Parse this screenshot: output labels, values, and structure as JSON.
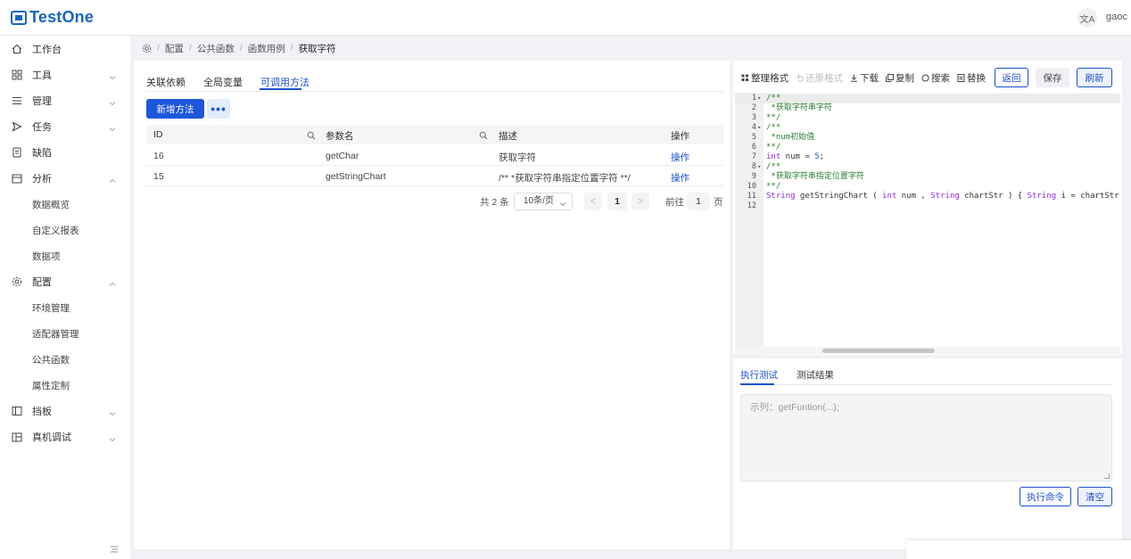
{
  "app": {
    "name": "TestOne",
    "lang_icon": "文A",
    "user": "gaoc"
  },
  "colors": {
    "accent": "#1e4fd0",
    "primary_button": "#1e57dc",
    "logo": "#1565c0",
    "comment": "#2e7d32"
  },
  "sidebar": {
    "items": [
      {
        "label": "工作台",
        "icon": "home-icon"
      },
      {
        "label": "工具",
        "icon": "grid-icon"
      },
      {
        "label": "管理",
        "icon": "list-icon"
      },
      {
        "label": "任务",
        "icon": "send-icon"
      },
      {
        "label": "缺陷",
        "icon": "document-icon"
      },
      {
        "label": "分析",
        "icon": "calendar-icon"
      },
      {
        "label": "数据概览"
      },
      {
        "label": "自定义报表"
      },
      {
        "label": "数据项"
      },
      {
        "label": "配置",
        "icon": "gear-icon"
      },
      {
        "label": "环境管理"
      },
      {
        "label": "适配器管理"
      },
      {
        "label": "公共函数"
      },
      {
        "label": "属性定制"
      },
      {
        "label": "挡板",
        "icon": "panel-icon"
      },
      {
        "label": "真机调试",
        "icon": "device-icon"
      }
    ]
  },
  "breadcrumb": [
    "配置",
    "公共函数",
    "函数用例",
    "获取字符"
  ],
  "left": {
    "tabs": [
      "关联依赖",
      "全局变量",
      "可调用方法"
    ],
    "add_button": "新增方法",
    "more_button": "•••",
    "table": {
      "headers": [
        "ID",
        "参数名",
        "描述",
        "操作"
      ],
      "rows": [
        {
          "id": "16",
          "name": "getChar",
          "desc": "获取字符",
          "action": "操作"
        },
        {
          "id": "15",
          "name": "getStringChart",
          "desc": "/** *获取字符串指定位置字符 **/",
          "action": "操作"
        }
      ]
    },
    "pager": {
      "total": "共 2 条",
      "size": "10条/页",
      "current": "1",
      "goto": "前往",
      "goto_value": "1",
      "page_suffix": "页",
      "prev": "<",
      "next": ">"
    }
  },
  "right": {
    "toolbar": {
      "format": "整理格式",
      "restore": "还原格式",
      "download": "下载",
      "copy": "复制",
      "search": "搜索",
      "replace": "替换",
      "back": "返回",
      "save": "保存",
      "refresh": "刷新"
    },
    "code_lines": [
      {
        "n": "1",
        "fold": "▾",
        "text": "/**"
      },
      {
        "n": "2",
        "fold": "",
        "text": " *获取字符串字符"
      },
      {
        "n": "3",
        "fold": "",
        "text": "**/"
      },
      {
        "n": "4",
        "fold": "▾",
        "text": "/**"
      },
      {
        "n": "5",
        "fold": "",
        "text": " *num初始值"
      },
      {
        "n": "6",
        "fold": "",
        "text": "**/"
      },
      {
        "n": "7",
        "fold": "",
        "text": "int num = 5;"
      },
      {
        "n": "8",
        "fold": "▾",
        "text": "/**"
      },
      {
        "n": "9",
        "fold": "",
        "text": " *获取字符串指定位置字符"
      },
      {
        "n": "10",
        "fold": "",
        "text": "**/"
      },
      {
        "n": "11",
        "fold": "",
        "text": "String getStringChart ( int num , String chartStr ) { String i = chartStr ; ch"
      },
      {
        "n": "12",
        "fold": "",
        "text": ""
      }
    ],
    "bottom_tabs": [
      "执行测试",
      "测试结果"
    ],
    "cmd_placeholder": "示列：getFuntion(...);",
    "exec_button": "执行命令",
    "clear_button": "清空"
  }
}
